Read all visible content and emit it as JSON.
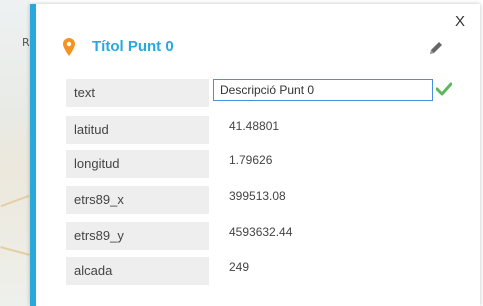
{
  "popup": {
    "title": "Títol Punt 0",
    "close_label": "X",
    "fields": [
      {
        "label": "text",
        "value": "Descripció Punt 0",
        "editing": true
      },
      {
        "label": "latitud",
        "value": "41.48801"
      },
      {
        "label": "longitud",
        "value": "1.79626"
      },
      {
        "label": "etrs89_x",
        "value": "399513.08"
      },
      {
        "label": "etrs89_y",
        "value": "4593632.44"
      },
      {
        "label": "alcada",
        "value": "249"
      }
    ],
    "icons": {
      "marker": "map-pin-icon",
      "edit": "pencil-icon",
      "confirm": "check-icon"
    },
    "colors": {
      "accent": "#29a8dc",
      "pin": "#f5931e",
      "check": "#5cb85c",
      "label_bg": "#eeeeee"
    }
  },
  "map": {
    "visible_label": "R"
  }
}
